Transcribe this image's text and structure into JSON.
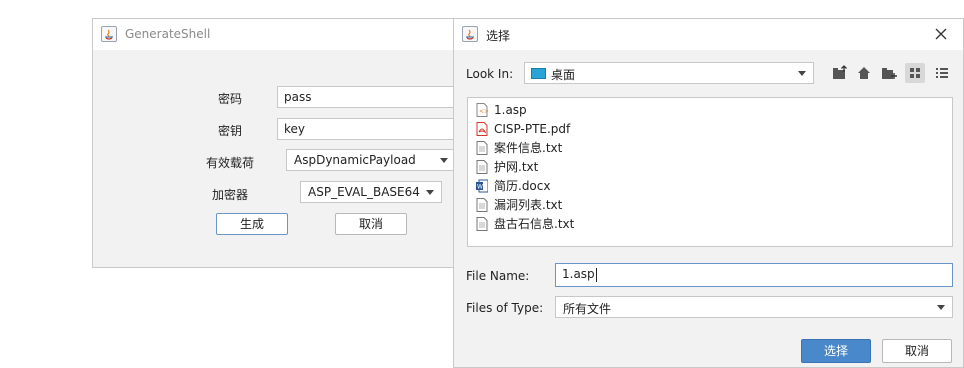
{
  "generate_shell": {
    "title": "GenerateShell",
    "password_label": "密码",
    "password_value": "pass",
    "key_label": "密钥",
    "key_value": "key",
    "payload_label": "有效载荷",
    "payload_value": "AspDynamicPayload",
    "encryptor_label": "加密器",
    "encryptor_value": "ASP_EVAL_BASE64",
    "generate_button": "生成",
    "cancel_button": "取消"
  },
  "file_chooser": {
    "title": "选择",
    "look_in_label": "Look In:",
    "look_in_value": "桌面",
    "files": [
      {
        "name": "1.asp",
        "type": "asp"
      },
      {
        "name": "CISP-PTE.pdf",
        "type": "pdf"
      },
      {
        "name": "案件信息.txt",
        "type": "txt"
      },
      {
        "name": "护网.txt",
        "type": "txt"
      },
      {
        "name": "简历.docx",
        "type": "docx"
      },
      {
        "name": "漏洞列表.txt",
        "type": "txt"
      },
      {
        "name": "盘古石信息.txt",
        "type": "txt"
      }
    ],
    "file_name_label": "File Name:",
    "file_name_value": "1.asp",
    "files_of_type_label": "Files of Type:",
    "files_of_type_value": "所有文件",
    "select_button": "选择",
    "cancel_button": "取消",
    "toolbar_icons": [
      "up-folder-icon",
      "home-icon",
      "new-folder-icon",
      "grid-view-icon",
      "list-view-icon"
    ]
  },
  "colors": {
    "accent": "#4a88cc",
    "pdf": "#d9342b",
    "word": "#2b5797"
  }
}
